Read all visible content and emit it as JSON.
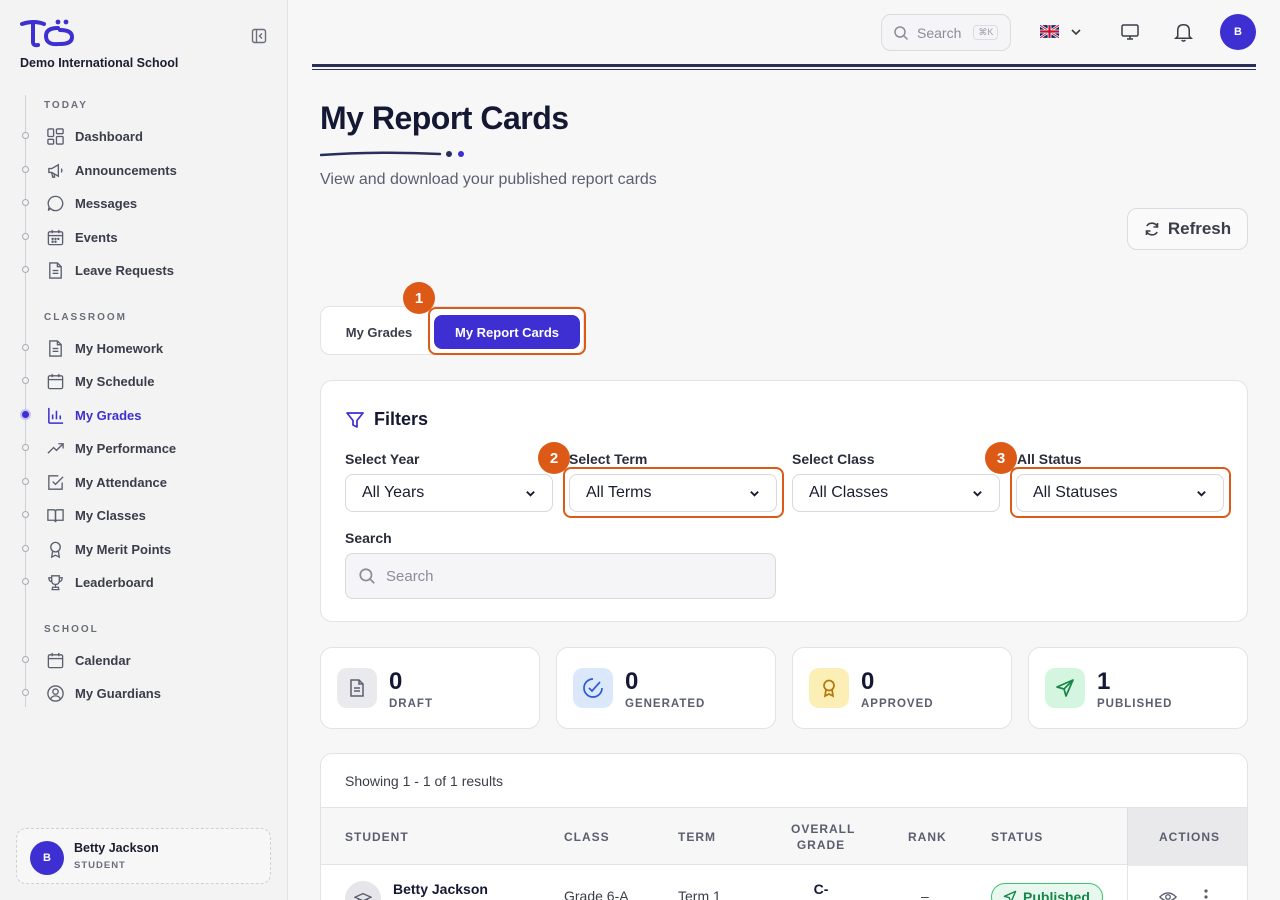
{
  "app": {
    "school_name": "Demo International School"
  },
  "sidebar": {
    "sections": [
      {
        "label": "TODAY"
      },
      {
        "label": "CLASSROOM"
      },
      {
        "label": "SCHOOL"
      }
    ],
    "items": [
      {
        "label": "Dashboard",
        "icon": "dashboard-icon"
      },
      {
        "label": "Announcements",
        "icon": "megaphone-icon"
      },
      {
        "label": "Messages",
        "icon": "chat-icon"
      },
      {
        "label": "Events",
        "icon": "calendar-icon"
      },
      {
        "label": "Leave Requests",
        "icon": "document-icon"
      },
      {
        "label": "My Homework",
        "icon": "document-icon"
      },
      {
        "label": "My Schedule",
        "icon": "calendar-icon"
      },
      {
        "label": "My Grades",
        "icon": "bar-chart-icon",
        "active": true
      },
      {
        "label": "My Performance",
        "icon": "trend-up-icon"
      },
      {
        "label": "My Attendance",
        "icon": "checkbox-icon"
      },
      {
        "label": "My Classes",
        "icon": "book-icon"
      },
      {
        "label": "My Merit Points",
        "icon": "award-icon"
      },
      {
        "label": "Leaderboard",
        "icon": "trophy-icon"
      },
      {
        "label": "Calendar",
        "icon": "calendar-icon"
      },
      {
        "label": "My Guardians",
        "icon": "user-circle-icon"
      }
    ],
    "user": {
      "initial": "B",
      "name": "Betty Jackson",
      "role": "STUDENT"
    }
  },
  "topbar": {
    "search_placeholder": "Search",
    "search_shortcut": "⌘K",
    "avatar_initial": "B"
  },
  "header": {
    "title": "My Report Cards",
    "subtitle": "View and download your published report cards",
    "refresh_label": "Refresh"
  },
  "tabs": [
    {
      "label": "My Grades"
    },
    {
      "label": "My Report Cards",
      "active": true
    }
  ],
  "callouts": [
    "1",
    "2",
    "3"
  ],
  "filters": {
    "title": "Filters",
    "year": {
      "label": "Select Year",
      "value": "All Years"
    },
    "term": {
      "label": "Select Term",
      "value": "All Terms"
    },
    "class": {
      "label": "Select Class",
      "value": "All Classes"
    },
    "status": {
      "label": "All Status",
      "value": "All Statuses"
    },
    "search": {
      "label": "Search",
      "placeholder": "Search"
    }
  },
  "stats": [
    {
      "value": "0",
      "label": "DRAFT",
      "icon": "document-icon"
    },
    {
      "value": "0",
      "label": "GENERATED",
      "icon": "check-badge-icon"
    },
    {
      "value": "0",
      "label": "APPROVED",
      "icon": "award-icon"
    },
    {
      "value": "1",
      "label": "PUBLISHED",
      "icon": "send-icon"
    }
  ],
  "results": {
    "showing": "Showing 1 - 1 of 1 results",
    "columns": [
      "STUDENT",
      "CLASS",
      "TERM",
      "OVERALL",
      "GRADE",
      "RANK",
      "STATUS",
      "ACTIONS"
    ],
    "rows": [
      {
        "student": "Betty Jackson",
        "class": "Grade 6-A",
        "term": "Term 1",
        "grade": "C-",
        "rank": "–",
        "status": "Published"
      }
    ]
  },
  "colors": {
    "accent": "#3d2fd1",
    "highlight": "#dd5a16",
    "published": "#18864a"
  }
}
